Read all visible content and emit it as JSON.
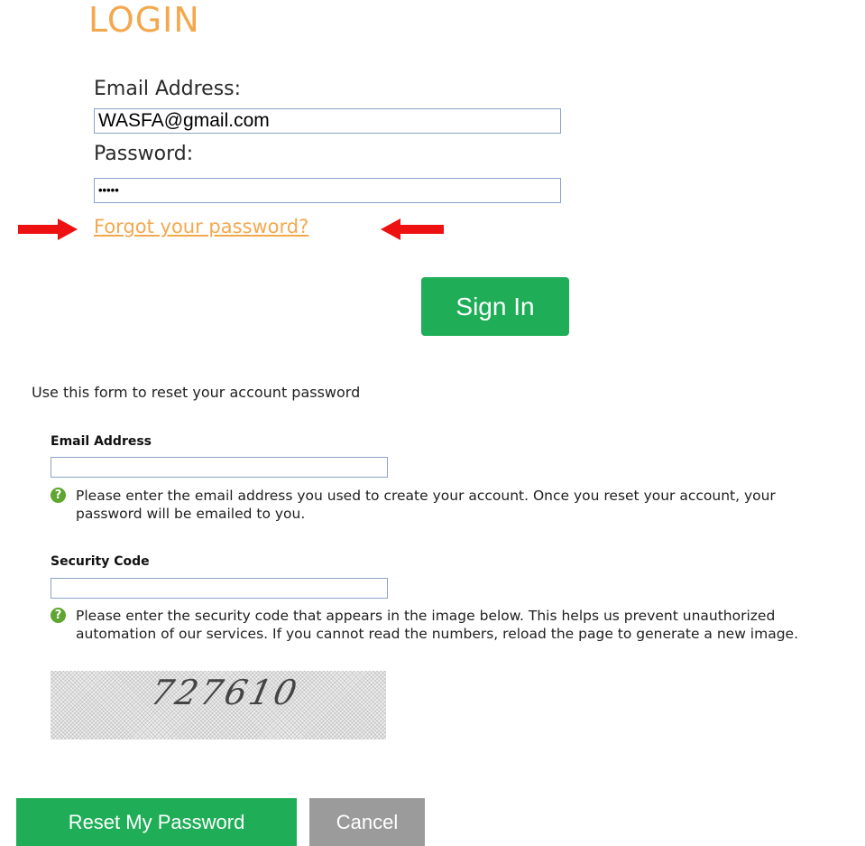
{
  "login": {
    "title": "LOGIN",
    "email_label": "Email Address:",
    "email_value": "WASFA@gmail.com",
    "password_label": "Password:",
    "password_value": "•••••",
    "forgot_link": "Forgot your password?",
    "signin_label": "Sign In"
  },
  "reset": {
    "intro": "Use this form to reset your account password",
    "email_label": "Email Address",
    "email_value": "",
    "email_help": "Please enter the email address you used to create your account. Once you reset your account, your password will be emailed to you.",
    "security_label": "Security Code",
    "security_value": "",
    "security_help": "Please enter the security code that appears in the image below. This helps us prevent unauthorized automation of our services. If you cannot read the numbers, reload the page to generate a new image.",
    "captcha_code": "727610",
    "help_icon": "?",
    "reset_button": "Reset My Password",
    "cancel_button": "Cancel"
  },
  "annotations": {
    "arrow_color": "#ee1111",
    "arrow_icons": [
      "arrow-right-icon",
      "arrow-left-icon"
    ]
  },
  "colors": {
    "accent_orange": "#f4a84e",
    "button_green": "#1fae57",
    "button_gray": "#9b9b9b",
    "help_icon_green": "#5fa52f"
  }
}
